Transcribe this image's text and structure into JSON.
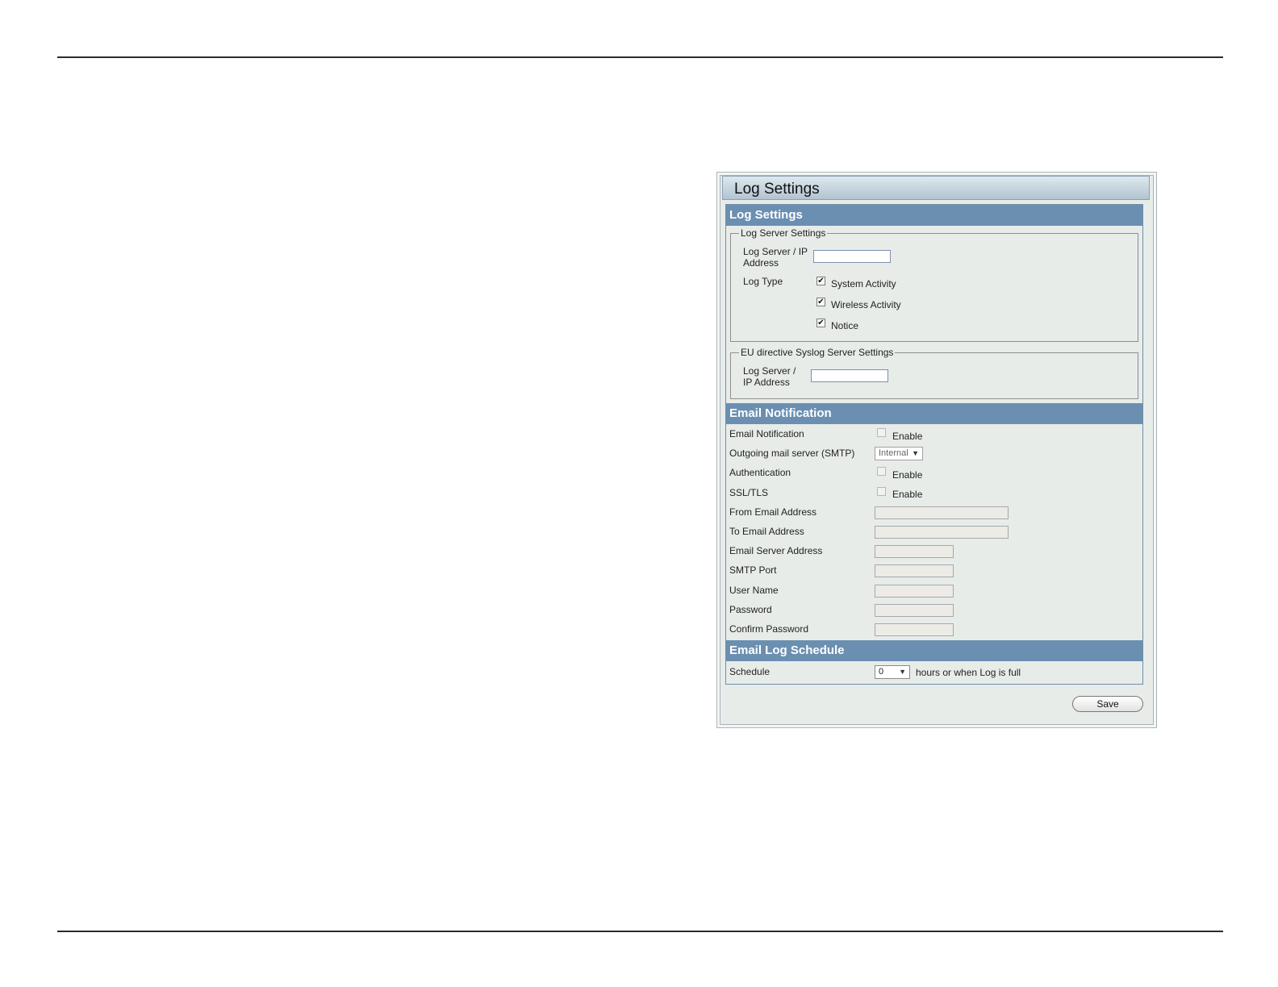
{
  "window": {
    "title": "Log Settings"
  },
  "log_settings": {
    "header": "Log Settings",
    "server_group": {
      "legend": "Log Server Settings",
      "ip_label_line1": "Log Server / IP",
      "ip_label_line2": "Address",
      "ip_value": "",
      "log_type_label": "Log Type",
      "types": [
        {
          "label": "System Activity",
          "checked": true
        },
        {
          "label": "Wireless Activity",
          "checked": true
        },
        {
          "label": "Notice",
          "checked": true
        }
      ]
    },
    "eu_group": {
      "legend": "EU directive Syslog Server Settings",
      "ip_label_line1": "Log Server /",
      "ip_label_line2": "IP Address",
      "ip_value": ""
    }
  },
  "email": {
    "header": "Email Notification",
    "email_notification_label": "Email Notification",
    "enable_label": "Enable",
    "smtp_label": "Outgoing mail server (SMTP)",
    "smtp_selected": "Internal",
    "auth_label": "Authentication",
    "ssl_label": "SSL/TLS",
    "from_label": "From Email Address",
    "to_label": "To Email Address",
    "server_label": "Email Server Address",
    "port_label": "SMTP Port",
    "user_label": "User Name",
    "password_label": "Password",
    "confirm_label": "Confirm Password"
  },
  "schedule": {
    "header": "Email Log Schedule",
    "label": "Schedule",
    "selected": "0",
    "suffix": "hours or when Log is full"
  },
  "save_label": "Save",
  "icons": {
    "checkmark": "checkmark-icon",
    "dropdown": "dropdown-arrow-icon"
  }
}
